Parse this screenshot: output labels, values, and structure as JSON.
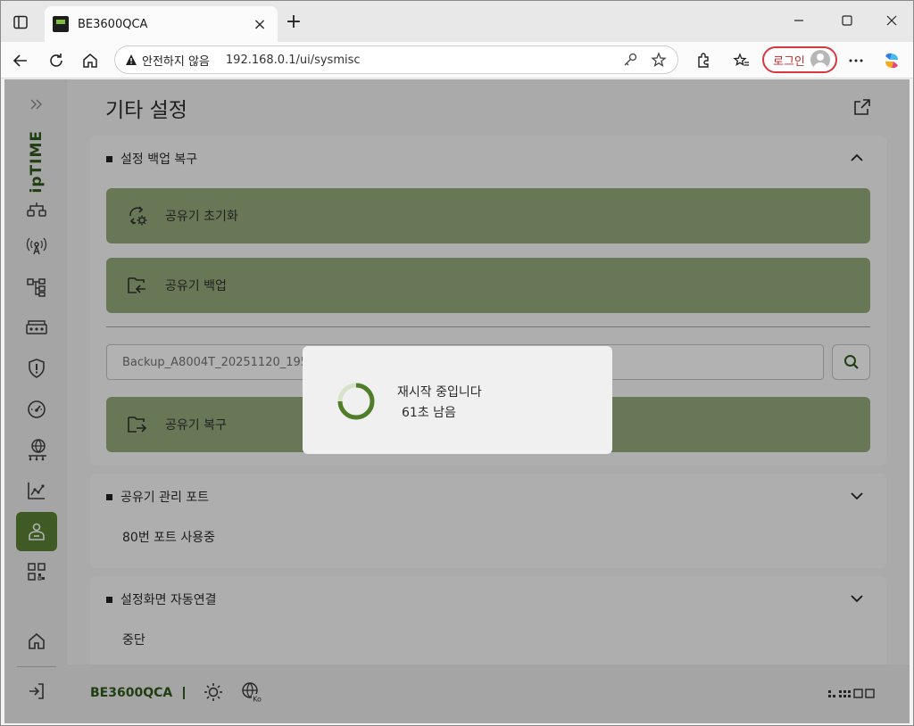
{
  "browser": {
    "tab_title": "BE3600QCA",
    "tab_close": "×",
    "new_tab": "+",
    "insecure_label": "안전하지 않음",
    "url": "192.168.0.1/ui/sysmisc",
    "login_label": "로그인"
  },
  "page": {
    "title": "기타 설정",
    "brand_logo": "ipTIME"
  },
  "backup_section": {
    "title": "설정 백업 복구",
    "reset_label": "공유기 초기화",
    "backup_label": "공유기 백업",
    "file_placeholder": "Backup_A8004T_20251120_195304.ezcfg",
    "restore_label": "공유기 복구"
  },
  "port_section": {
    "title": "공유기 관리 포트",
    "value": "80번 포트 사용중"
  },
  "autoconnect_section": {
    "title": "설정화면 자동연결",
    "value": "중단"
  },
  "footer": {
    "model": "BE3600QCA",
    "lang_badge": "Ko"
  },
  "modal": {
    "title": "재시작 중입니다",
    "countdown": "61초 남음"
  },
  "colors": {
    "accent": "#5b8234",
    "action_bar": "#95ad7c",
    "brand_text": "#2f5a1a",
    "login_border": "#d9363e"
  },
  "icons": {
    "reset": "reset-gear-icon",
    "backup": "folder-export-icon",
    "restore": "folder-import-icon",
    "search": "search-icon",
    "spinner": "loading-spinner-icon"
  }
}
